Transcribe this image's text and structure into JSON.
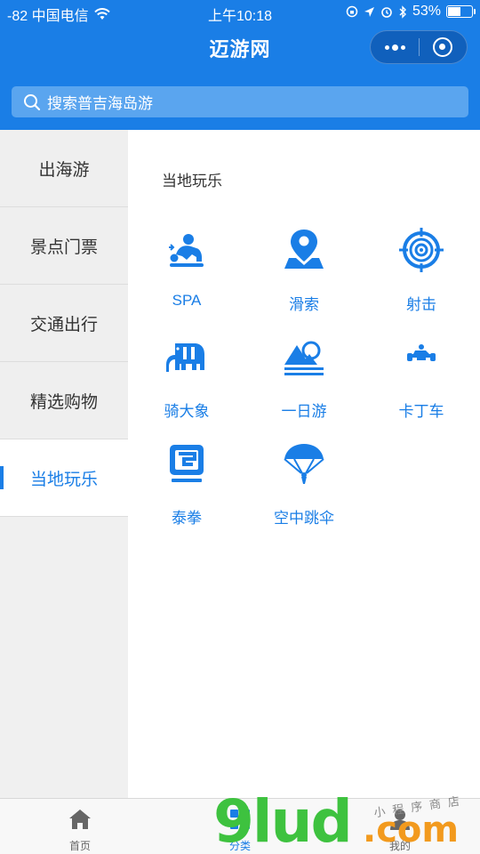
{
  "status_bar": {
    "carrier": "-82 中国电信",
    "time": "上午10:18",
    "battery": "53%"
  },
  "nav": {
    "title": "迈游网"
  },
  "search": {
    "placeholder": "搜索普吉海岛游"
  },
  "sidebar": {
    "items": [
      {
        "label": "出海游"
      },
      {
        "label": "景点门票"
      },
      {
        "label": "交通出行"
      },
      {
        "label": "精选购物"
      },
      {
        "label": "当地玩乐",
        "active": true
      }
    ]
  },
  "content": {
    "section_title": "当地玩乐",
    "items": [
      {
        "label": "SPA",
        "icon": "massage-icon"
      },
      {
        "label": "滑索",
        "icon": "map-pin-icon"
      },
      {
        "label": "射击",
        "icon": "target-icon"
      },
      {
        "label": "骑大象",
        "icon": "elephant-icon"
      },
      {
        "label": "一日游",
        "icon": "mountain-sun-icon"
      },
      {
        "label": "卡丁车",
        "icon": "go-kart-icon"
      },
      {
        "label": "泰拳",
        "icon": "boxing-ring-icon"
      },
      {
        "label": "空中跳伞",
        "icon": "parachute-icon"
      }
    ]
  },
  "tabbar": {
    "tabs": [
      {
        "label": "首页",
        "icon": "home-icon"
      },
      {
        "label": "分类",
        "icon": "category-icon",
        "active": true
      },
      {
        "label": "我的",
        "icon": "user-icon"
      }
    ]
  },
  "watermark": {
    "brand": "9lud",
    "suffix": ".com",
    "tagline": "小程序商店"
  },
  "colors": {
    "primary": "#1a7ee6",
    "sidebar_bg": "#efefef",
    "text": "#333333"
  }
}
